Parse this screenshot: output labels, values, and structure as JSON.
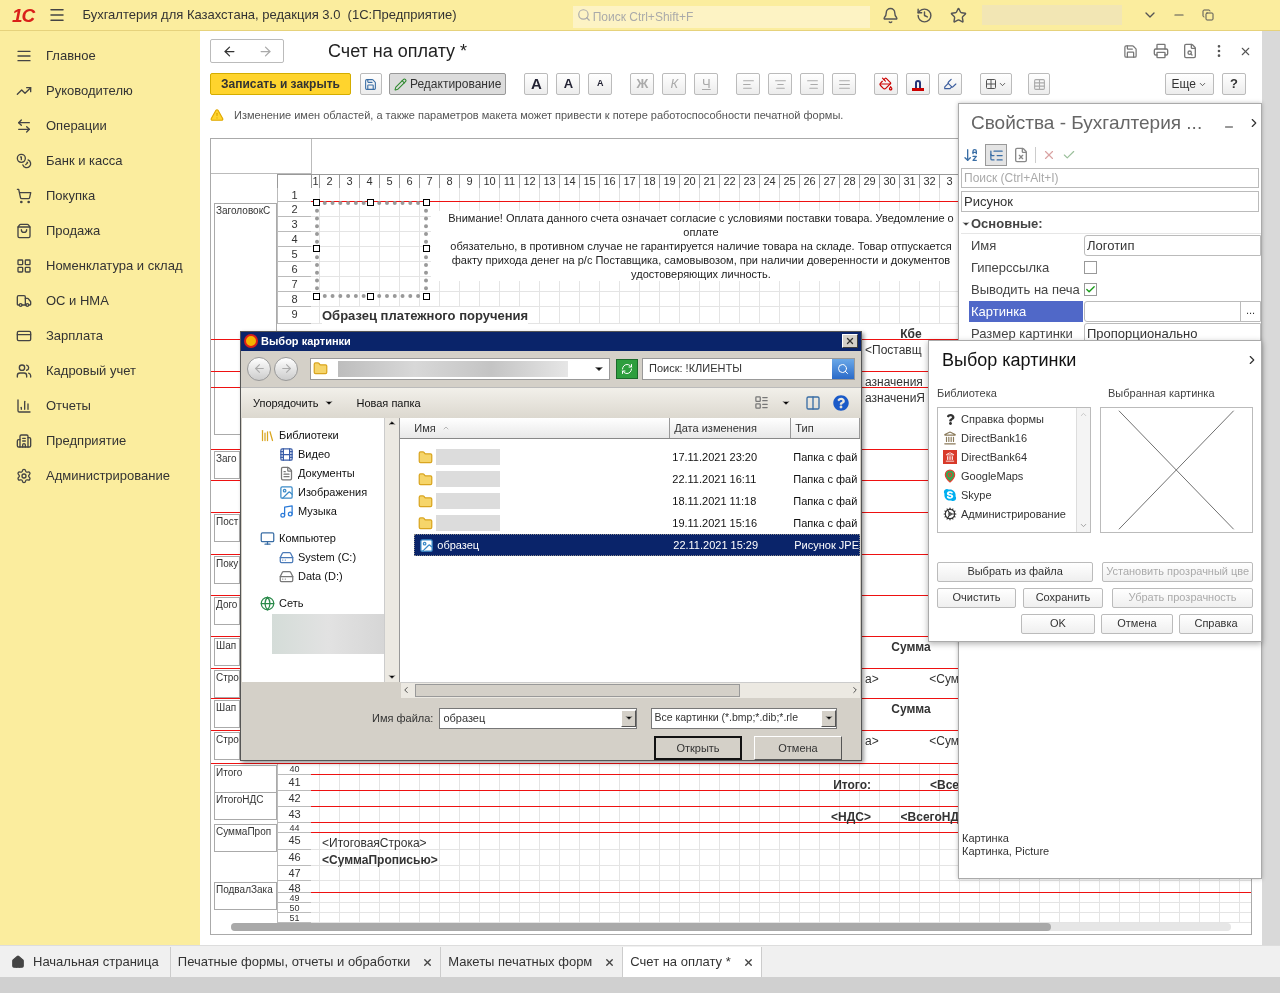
{
  "header": {
    "logo": "1С",
    "title": "Бухгалтерия для Казахстана, редакция 3.0  (1С:Предприятие)",
    "search_placeholder": "Поиск Ctrl+Shift+F"
  },
  "sidebar": {
    "items": [
      {
        "label": "Главное"
      },
      {
        "label": "Руководителю"
      },
      {
        "label": "Операции"
      },
      {
        "label": "Банк и касса"
      },
      {
        "label": "Покупка"
      },
      {
        "label": "Продажа"
      },
      {
        "label": "Номенклатура и склад"
      },
      {
        "label": "ОС и НМА"
      },
      {
        "label": "Зарплата"
      },
      {
        "label": "Кадровый учет"
      },
      {
        "label": "Отчеты"
      },
      {
        "label": "Предприятие"
      },
      {
        "label": "Администрирование"
      }
    ]
  },
  "document": {
    "title": "Счет на оплату *",
    "save_close": "Записать и закрыть",
    "edit_mode": {
      "label": "Редактирование",
      "selected": true
    },
    "font_buttons": [
      {
        "label": "A",
        "kind": "plain"
      },
      {
        "label": "A",
        "kind": "increase"
      },
      {
        "label": "A",
        "kind": "decrease"
      }
    ],
    "style_buttons": [
      {
        "label": "Ж",
        "kind": "bold",
        "disabled": true
      },
      {
        "label": "К",
        "kind": "italic",
        "disabled": true
      },
      {
        "label": "Ч",
        "kind": "underline",
        "disabled": true
      }
    ],
    "more": "Еще",
    "help": "?",
    "warning": "Изменение имен областей, а также параметров макета может привести к потере работоспособности печатной формы."
  },
  "sheet": {
    "columns": [
      "1",
      "2",
      "3",
      "4",
      "5",
      "6",
      "7",
      "8",
      "9",
      "10",
      "11",
      "12",
      "13",
      "14",
      "15",
      "16",
      "17",
      "18",
      "19",
      "20",
      "21",
      "22",
      "23",
      "24",
      "25",
      "26",
      "27",
      "28",
      "29",
      "30",
      "31",
      "32",
      "3"
    ],
    "top_rows": [
      {
        "number": "1"
      },
      {
        "number": "2",
        "region": {
          "label": "ЗаголовокС",
          "kind": "tall"
        }
      },
      {
        "number": "3"
      },
      {
        "number": "4"
      },
      {
        "number": "5"
      },
      {
        "number": "6"
      },
      {
        "number": "7"
      },
      {
        "number": "8"
      },
      {
        "number": "9",
        "cells": [
          {
            "text": "Образец платежного поручения",
            "kind": "heading"
          }
        ]
      }
    ],
    "notice": [
      "Внимание! Оплата данного счета означает согласие с условиями поставки товара. Уведомление о",
      "оплате",
      "обязательно, в противном случае не гарантируется наличие товара на складе. Товар отпускается",
      "факту  прихода денег на р/с Поставщика, самовывозом, при наличии доверенности и документов",
      "удостоверяющих личность."
    ],
    "middle_rows": [
      {
        "cells": [
          {
            "text": "Кбе",
            "kind": "center"
          }
        ]
      },
      {
        "cells": [
          {
            "text": "<Поставщ",
            "kind": "left"
          }
        ]
      },
      {
        "cells": [
          {
            "text": "азначения",
            "kind": "left"
          }
        ]
      },
      {
        "cells": [
          {
            "text": "азначениЯ",
            "kind": "left"
          }
        ]
      },
      {
        "region": {
          "label": "Заго",
          "kind": "clipped"
        }
      },
      {},
      {
        "region": {
          "label": "Пост",
          "kind": "clipped"
        }
      },
      {
        "region": {
          "label": "Поку",
          "kind": "clipped"
        }
      },
      {
        "region": {
          "label": "Дого",
          "kind": "clipped"
        }
      },
      {
        "region": {
          "label": "Шап",
          "kind": "clipped"
        },
        "cells": [
          {
            "text": "Сумма",
            "kind": "center"
          }
        ]
      },
      {
        "region": {
          "label": "Стро",
          "kind": "clipped"
        },
        "cells": [
          {
            "text": "а>",
            "kind": "left"
          },
          {
            "text": "<Сум",
            "kind": "right"
          }
        ]
      },
      {
        "region": {
          "label": "Шап",
          "kind": "clipped"
        },
        "cells": [
          {
            "text": "Сумма",
            "kind": "center"
          }
        ]
      },
      {
        "region": {
          "label": "Стро",
          "kind": "clipped"
        },
        "cells": [
          {
            "text": "а>",
            "kind": "left"
          },
          {
            "text": "<Сум",
            "kind": "right"
          }
        ]
      }
    ],
    "bottom_rows": [
      {
        "number": "40",
        "region": {
          "label": "Итого",
          "kind": "short"
        }
      },
      {
        "number": "41",
        "cells": [
          {
            "text": "Итого:",
            "kind": "total_label"
          },
          {
            "text": "<Все",
            "kind": "total_value"
          }
        ]
      },
      {
        "number": "42",
        "region": {
          "label": "ИтогоНДС",
          "kind": "short"
        }
      },
      {
        "number": "43",
        "cells": [
          {
            "text": "<НДС>",
            "kind": "total_label"
          },
          {
            "text": "<ВсегоНД",
            "kind": "total_value"
          }
        ]
      },
      {
        "number": "44",
        "region": {
          "label": "СуммаПроп",
          "kind": "short"
        }
      },
      {
        "number": "45",
        "cells": [
          {
            "text": "<ИтоговаяСтрока>",
            "kind": "text"
          }
        ]
      },
      {
        "number": "46",
        "cells": [
          {
            "text": "<СуммаПрописью>",
            "kind": "heading"
          }
        ]
      },
      {
        "number": "47"
      },
      {
        "number": "48",
        "region": {
          "label": "ПодвалЗака",
          "kind": "short"
        }
      },
      {
        "number": "49"
      },
      {
        "number": "50"
      },
      {
        "number": "51"
      }
    ]
  },
  "properties": {
    "title": "Свойства - Бухгалтерия ...",
    "search_placeholder": "Поиск (Ctrl+Alt+I)",
    "object": "Рисунок",
    "section": {
      "label": "Основные:",
      "expanded": true
    },
    "rows": [
      {
        "label": "Имя",
        "kind": "text",
        "value": "Логотип",
        "selected": false
      },
      {
        "label": "Гиперссылка",
        "kind": "checkbox",
        "checked": false,
        "selected": false
      },
      {
        "label": "Выводить на печа",
        "kind": "checkbox",
        "checked": true,
        "selected": false
      },
      {
        "label": "Картинка",
        "kind": "picker",
        "button": "...",
        "selected": true
      },
      {
        "label": "Размер картинки",
        "kind": "text",
        "value": "Пропорционально",
        "selected": false
      }
    ],
    "footer": [
      "Картинка",
      "Картинка, Picture"
    ]
  },
  "picture_dialog": {
    "title": "Выбор картинки",
    "library_label": "Библиотека",
    "preview_label": "Выбранная картинка",
    "library": [
      {
        "label": "Справка формы",
        "kind": "help"
      },
      {
        "label": "DirectBank16",
        "kind": "bank"
      },
      {
        "label": "DirectBank64",
        "kind": "bank-red"
      },
      {
        "label": "GoogleMaps",
        "kind": "map"
      },
      {
        "label": "Skype",
        "kind": "skype"
      },
      {
        "label": "Администрирование",
        "kind": "gear"
      }
    ],
    "buttons": [
      {
        "label": "Выбрать из файла",
        "disabled": false
      },
      {
        "label": "Установить прозрачный цве",
        "disabled": true
      },
      {
        "label": "Очистить",
        "disabled": false
      },
      {
        "label": "Сохранить",
        "disabled": false
      },
      {
        "label": "Убрать прозрачность",
        "disabled": true
      },
      {
        "label": "OK",
        "disabled": false
      },
      {
        "label": "Отмена",
        "disabled": false
      },
      {
        "label": "Справка",
        "disabled": false
      }
    ]
  },
  "file_dialog": {
    "title": "Выбор картинки",
    "search": "Поиск: !КЛИЕНТЫ",
    "organize": "Упорядочить",
    "new_folder": "Новая папка",
    "tree": [
      {
        "label": "Библиотеки",
        "kind": "library",
        "children": [
          {
            "label": "Видео",
            "kind": "video"
          },
          {
            "label": "Документы",
            "kind": "document"
          },
          {
            "label": "Изображения",
            "kind": "image"
          },
          {
            "label": "Музыка",
            "kind": "music"
          }
        ]
      },
      {
        "label": "Компьютер",
        "kind": "computer",
        "children": [
          {
            "label": "System (C:)",
            "kind": "system-drive"
          },
          {
            "label": "Data (D:)",
            "kind": "drive"
          }
        ]
      },
      {
        "label": "Сеть",
        "kind": "network"
      }
    ],
    "columns": [
      "Имя",
      "Дата изменения",
      "Тип"
    ],
    "files": [
      {
        "kind": "folder",
        "date": "17.11.2021 23:20",
        "type": "Папка с фай",
        "selected": false
      },
      {
        "kind": "folder",
        "date": "22.11.2021 16:11",
        "type": "Папка с фай",
        "selected": false
      },
      {
        "kind": "folder",
        "date": "18.11.2021 11:18",
        "type": "Папка с фай",
        "selected": false
      },
      {
        "kind": "folder",
        "date": "19.11.2021 15:16",
        "type": "Папка с фай",
        "selected": false
      },
      {
        "kind": "image",
        "name": "образец",
        "date": "22.11.2021 15:29",
        "type": "Рисунок JPE",
        "selected": true
      }
    ],
    "filename_label": "Имя файла:",
    "filename": "образец",
    "filter": "Все картинки (*.bmp;*.dib;*.rle",
    "open": "Открыть",
    "cancel": "Отмена"
  },
  "tabs": [
    {
      "label": "Начальная страница",
      "kind": "home",
      "selected": false
    },
    {
      "label": "Печатные формы, отчеты и обработки",
      "kind": "closable",
      "selected": false
    },
    {
      "label": "Макеты печатных форм",
      "kind": "closable",
      "selected": false
    },
    {
      "label": "Счет на оплату *",
      "kind": "closable",
      "selected": true
    }
  ]
}
